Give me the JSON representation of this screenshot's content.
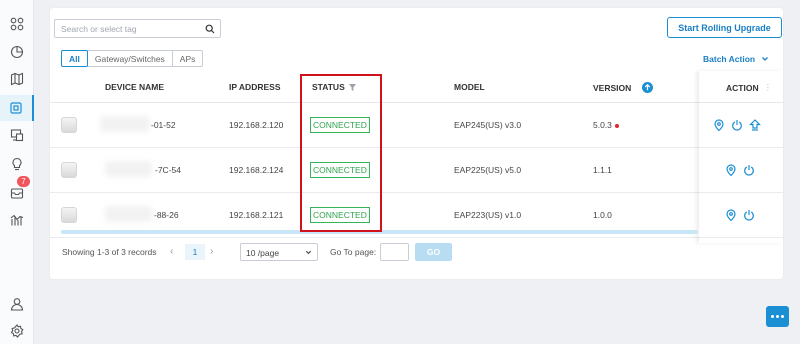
{
  "sidebar": {
    "items": [
      {
        "icon": "dashboard-icon"
      },
      {
        "icon": "statistics-icon"
      },
      {
        "icon": "map-icon"
      },
      {
        "icon": "devices-icon",
        "active": true
      },
      {
        "icon": "clients-icon"
      },
      {
        "icon": "insight-icon"
      },
      {
        "icon": "alerts-icon",
        "badge": "7"
      },
      {
        "icon": "reports-icon"
      }
    ],
    "bottom": [
      {
        "icon": "user-icon"
      },
      {
        "icon": "settings-icon"
      }
    ]
  },
  "toolbar": {
    "search_placeholder": "Search or select tag",
    "rolling_upgrade_label": "Start Rolling Upgrade",
    "batch_action_label": "Batch Action"
  },
  "tabs": [
    "All",
    "Gateway/Switches",
    "APs"
  ],
  "table": {
    "columns": {
      "device_name": "DEVICE NAME",
      "ip_address": "IP ADDRESS",
      "status": "STATUS",
      "model": "MODEL",
      "version": "VERSION",
      "action": "ACTION"
    },
    "rows": [
      {
        "device_name": "-01-52",
        "ip": "192.168.2.120",
        "status": "CONNECTED",
        "model": "EAP245(US) v3.0",
        "version": "5.0.3",
        "upgrade_available": true
      },
      {
        "device_name": "-7C-54",
        "ip": "192.168.2.124",
        "status": "CONNECTED",
        "model": "EAP225(US) v5.0",
        "version": "1.1.1",
        "upgrade_available": false
      },
      {
        "device_name": "-88-26",
        "ip": "192.168.2.121",
        "status": "CONNECTED",
        "model": "EAP223(US) v1.0",
        "version": "1.0.0",
        "upgrade_available": false
      }
    ]
  },
  "pagination": {
    "records_text": "Showing 1-3 of 3 records",
    "current_page": "1",
    "per_page": "10 /page",
    "goto_label": "Go To page:",
    "go_label": "GO"
  },
  "colors": {
    "accent": "#1a8fd3",
    "connected": "#2ea44f",
    "highlight_box": "#d0121b",
    "badge": "#f2545b"
  }
}
